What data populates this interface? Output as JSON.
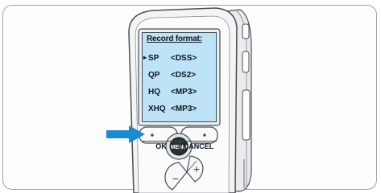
{
  "screen": {
    "title": "Record format:",
    "rows": [
      {
        "selected": true,
        "quality": "SP",
        "format": "<DSS>"
      },
      {
        "selected": false,
        "quality": "QP",
        "format": "<DS2>"
      },
      {
        "selected": false,
        "quality": "HQ",
        "format": "<MP3>"
      },
      {
        "selected": false,
        "quality": "XHQ",
        "format": "<MP3>"
      }
    ],
    "selector_glyph": "▸",
    "softkey_left": "OK",
    "softkey_right": "CANCEL"
  },
  "device": {
    "menu_button": "MENU",
    "plus_symbol": "+",
    "minus_symbol": "−"
  },
  "colors": {
    "lcd": "#bfe3f6",
    "pointer_arrow": "#1a8ad4",
    "device_body": "#f3f4f5",
    "outline": "#4a4f55"
  },
  "icons": [
    "pointer-arrow-icon",
    "menu-button",
    "plus-icon",
    "minus-icon"
  ]
}
